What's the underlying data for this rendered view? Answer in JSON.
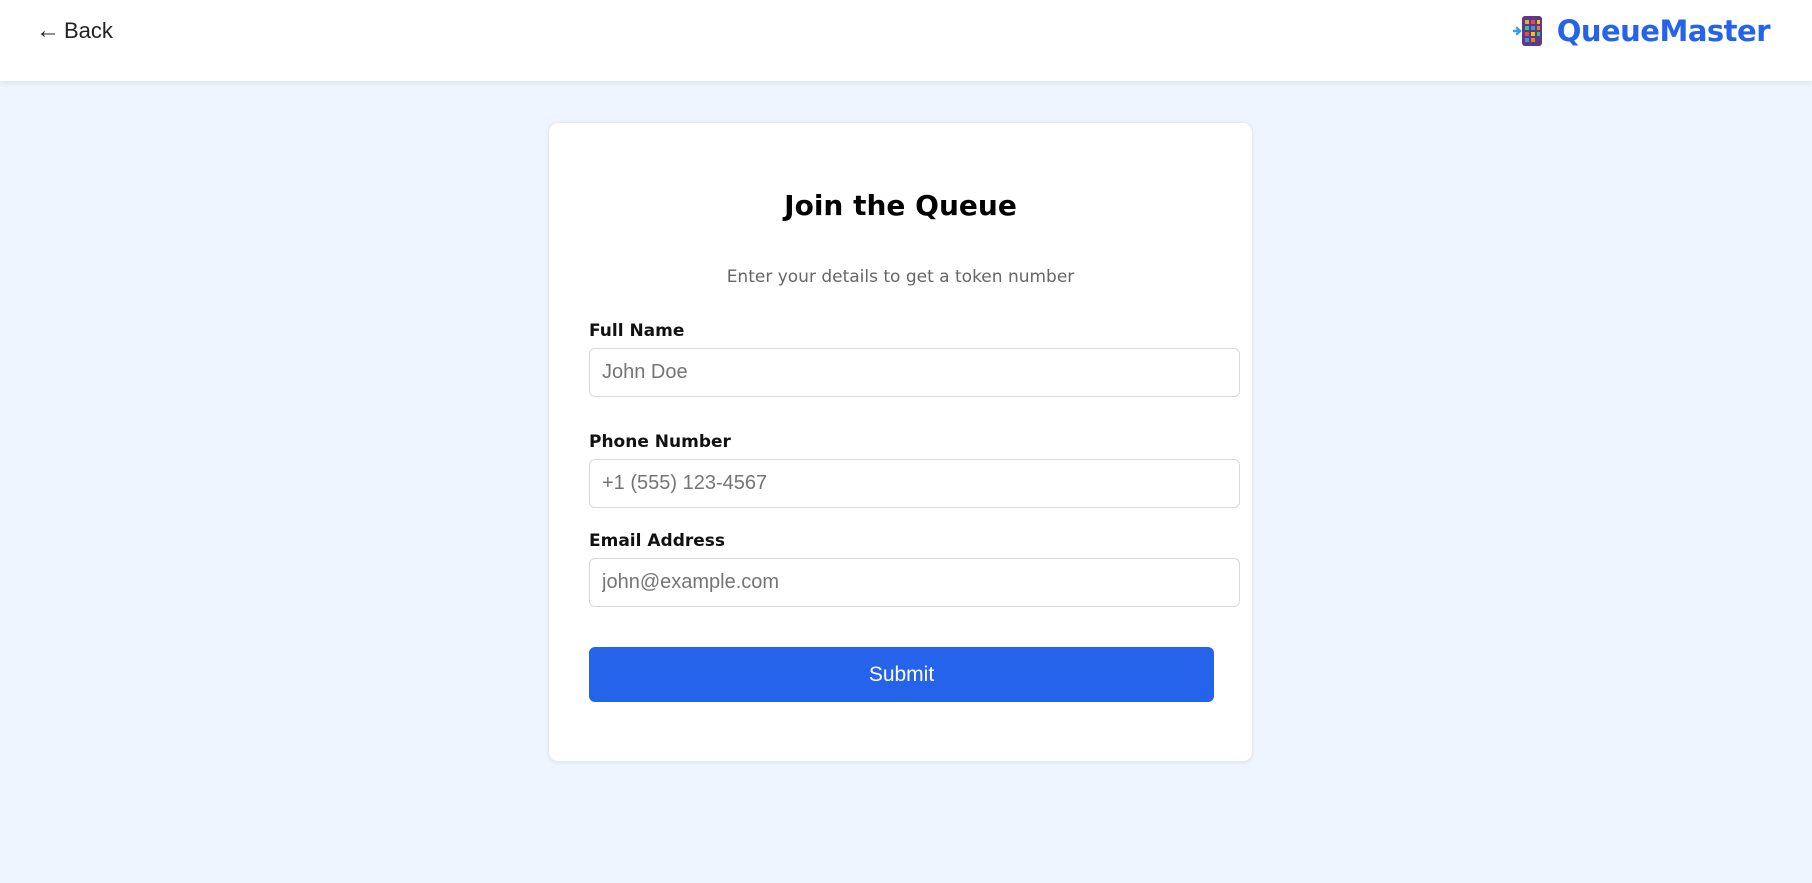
{
  "header": {
    "back_label": "Back",
    "back_icon": "arrow-left-icon",
    "brand_name": "QueueMaster",
    "brand_icon": "queue-app-icon"
  },
  "form": {
    "title": "Join the Queue",
    "subtitle": "Enter your details to get a token number",
    "fields": [
      {
        "label": "Full Name",
        "placeholder": "John Doe",
        "value": ""
      },
      {
        "label": "Phone Number",
        "placeholder": "+1 (555) 123-4567",
        "value": ""
      },
      {
        "label": "Email Address",
        "placeholder": "john@example.com",
        "value": ""
      }
    ],
    "submit_label": "Submit"
  },
  "colors": {
    "accent": "#2563eb",
    "page_background": "#eef5fe",
    "card_background": "#ffffff"
  }
}
